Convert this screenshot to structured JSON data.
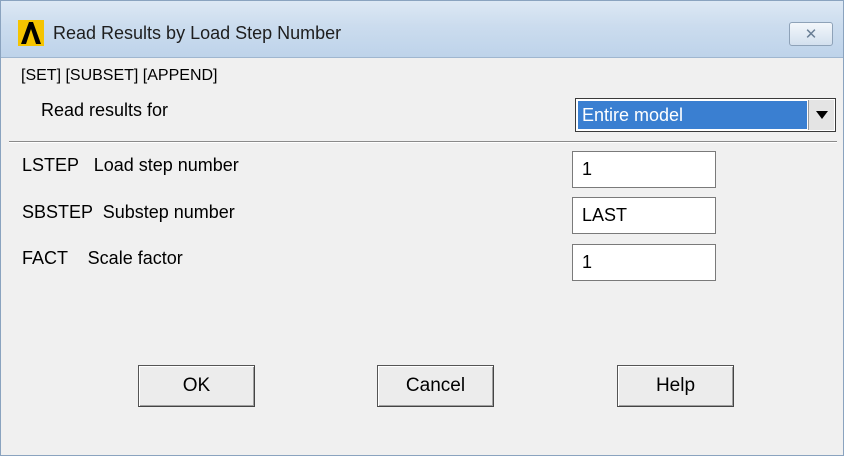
{
  "window": {
    "title": "Read Results by Load Step Number",
    "close_glyph": "✕"
  },
  "dialog": {
    "command_label": "[SET] [SUBSET] [APPEND]",
    "read_results_label": "Read results for",
    "read_results_value": "Entire model",
    "fields": [
      {
        "label": "LSTEP   Load step number",
        "value": "1"
      },
      {
        "label": "SBSTEP  Substep number",
        "value": "LAST"
      },
      {
        "label": "FACT    Scale factor",
        "value": "1"
      }
    ],
    "buttons": {
      "ok": "OK",
      "cancel": "Cancel",
      "help": "Help"
    }
  },
  "colors": {
    "selection": "#3a7fd1",
    "titlebar": "#cbdcee"
  },
  "icons": {
    "app_logo": "ansys-logo-icon",
    "close": "close-icon",
    "dropdown": "dropdown-arrow-icon"
  }
}
